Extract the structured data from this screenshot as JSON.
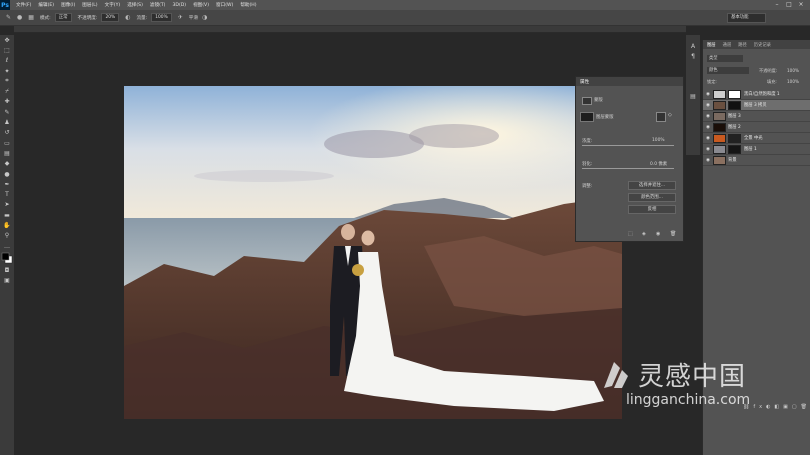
{
  "app": {
    "logo": "Ps"
  },
  "menu": [
    "文件(F)",
    "编辑(E)",
    "图像(I)",
    "图层(L)",
    "文字(Y)",
    "选择(S)",
    "滤镜(T)",
    "3D(D)",
    "视图(V)",
    "窗口(W)",
    "帮助(H)"
  ],
  "options_bar": {
    "mode_label": "模式:",
    "mode_value": "正常",
    "opacity_label": "不透明度:",
    "opacity_value": "20%",
    "flow_label": "流量:",
    "flow_value": "100%",
    "extra": "平滑",
    "workspace": "基本功能"
  },
  "properties": {
    "title": "属性",
    "type_label": "蒙版",
    "layer_mask_label": "图层蒙版",
    "density_label": "浓度:",
    "density_value": "100%",
    "feather_label": "羽化:",
    "feather_value": "0.0 像素",
    "adjust_label": "调整:",
    "btn_select": "选择并遮住...",
    "btn_color": "颜色范围...",
    "btn_invert": "反相"
  },
  "layers_panel": {
    "tabs": [
      "图层",
      "通道",
      "路径",
      "历史记录"
    ],
    "filter_kind": "类型",
    "blend_mode": "颜色",
    "opacity_label": "不透明度:",
    "opacity_value": "100%",
    "lock_label": "锁定:",
    "fill_label": "填充:",
    "fill_value": "100%",
    "layers": [
      {
        "name": "黑白/自然饱和度 1",
        "visible": true,
        "thumb": "#cfcfcf",
        "mask": "#ffffff"
      },
      {
        "name": "图层 3 拷贝",
        "visible": true,
        "thumb": "#6a5040",
        "mask": "#111111",
        "selected": true
      },
      {
        "name": "图层 3",
        "visible": true,
        "thumb": "#7a6a60",
        "mask": ""
      },
      {
        "name": "图层 2",
        "visible": true,
        "thumb": "#1a0e08",
        "mask": ""
      },
      {
        "name": "全景 中光",
        "visible": true,
        "thumb": "#c85a20",
        "mask": "#222222"
      },
      {
        "name": "图层 1",
        "visible": true,
        "thumb": "#8a8a90",
        "mask": "#151515"
      },
      {
        "name": "背景",
        "visible": true,
        "thumb": "#8a7060",
        "mask": ""
      }
    ]
  },
  "watermark": {
    "cn": "灵感中国",
    "url": "lingganchina.com"
  },
  "colors": {
    "accent": "#31a8ff",
    "panel": "#535353",
    "canvas_bg": "#282828"
  }
}
